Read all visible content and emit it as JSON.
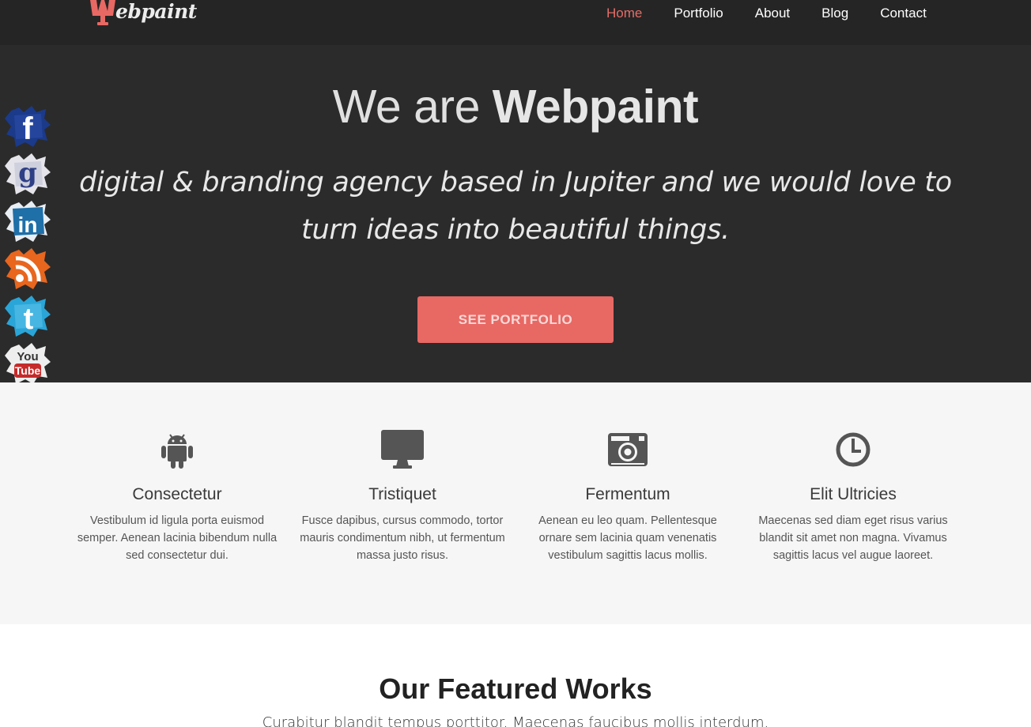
{
  "header": {
    "logo_text": "ebpaint",
    "nav": [
      {
        "label": "Home",
        "active": true
      },
      {
        "label": "Portfolio",
        "active": false
      },
      {
        "label": "About",
        "active": false
      },
      {
        "label": "Blog",
        "active": false
      },
      {
        "label": "Contact",
        "active": false
      }
    ]
  },
  "hero": {
    "title_thin": "We are ",
    "title_bold": "Webpaint",
    "subtitle": "digital & branding agency based in Jupiter and we would love to turn ideas into beautiful things.",
    "cta_label": "SEE PORTFOLIO"
  },
  "social": [
    {
      "name": "facebook",
      "glyph": "f",
      "color": "#1b3a8a"
    },
    {
      "name": "google",
      "glyph": "g",
      "color": "#3a4d8f"
    },
    {
      "name": "linkedin",
      "glyph": "in",
      "color": "#1f6fa8"
    },
    {
      "name": "rss",
      "glyph": "rss",
      "color": "#e8661e"
    },
    {
      "name": "twitter",
      "glyph": "t",
      "color": "#2aa5d8"
    },
    {
      "name": "youtube",
      "glyph": "You Tube",
      "color": "#c62a2a"
    }
  ],
  "features": [
    {
      "icon": "android-icon",
      "title": "Consectetur",
      "text": "Vestibulum id ligula porta euismod semper. Aenean lacinia bibendum nulla sed consectetur dui."
    },
    {
      "icon": "monitor-icon",
      "title": "Tristiquet",
      "text": "Fusce dapibus, cursus commodo, tortor mauris condimentum nibh, ut fermentum massa justo risus."
    },
    {
      "icon": "camera-icon",
      "title": "Fermentum",
      "text": "Aenean eu leo quam. Pellentesque ornare sem lacinia quam venenatis vestibulum sagittis lacus mollis."
    },
    {
      "icon": "clock-icon",
      "title": "Elit Ultricies",
      "text": "Maecenas sed diam eget risus varius blandit sit amet non magna. Vivamus sagittis lacus vel augue laoreet."
    }
  ],
  "works": {
    "title": "Our Featured Works",
    "subtitle": "Curabitur blandit tempus porttitor. Maecenas faucibus mollis interdum."
  },
  "colors": {
    "accent": "#e86864",
    "nav_bg": "#252525",
    "hero_bg": "#2b2b2b",
    "features_bg": "#f6f6f6"
  }
}
